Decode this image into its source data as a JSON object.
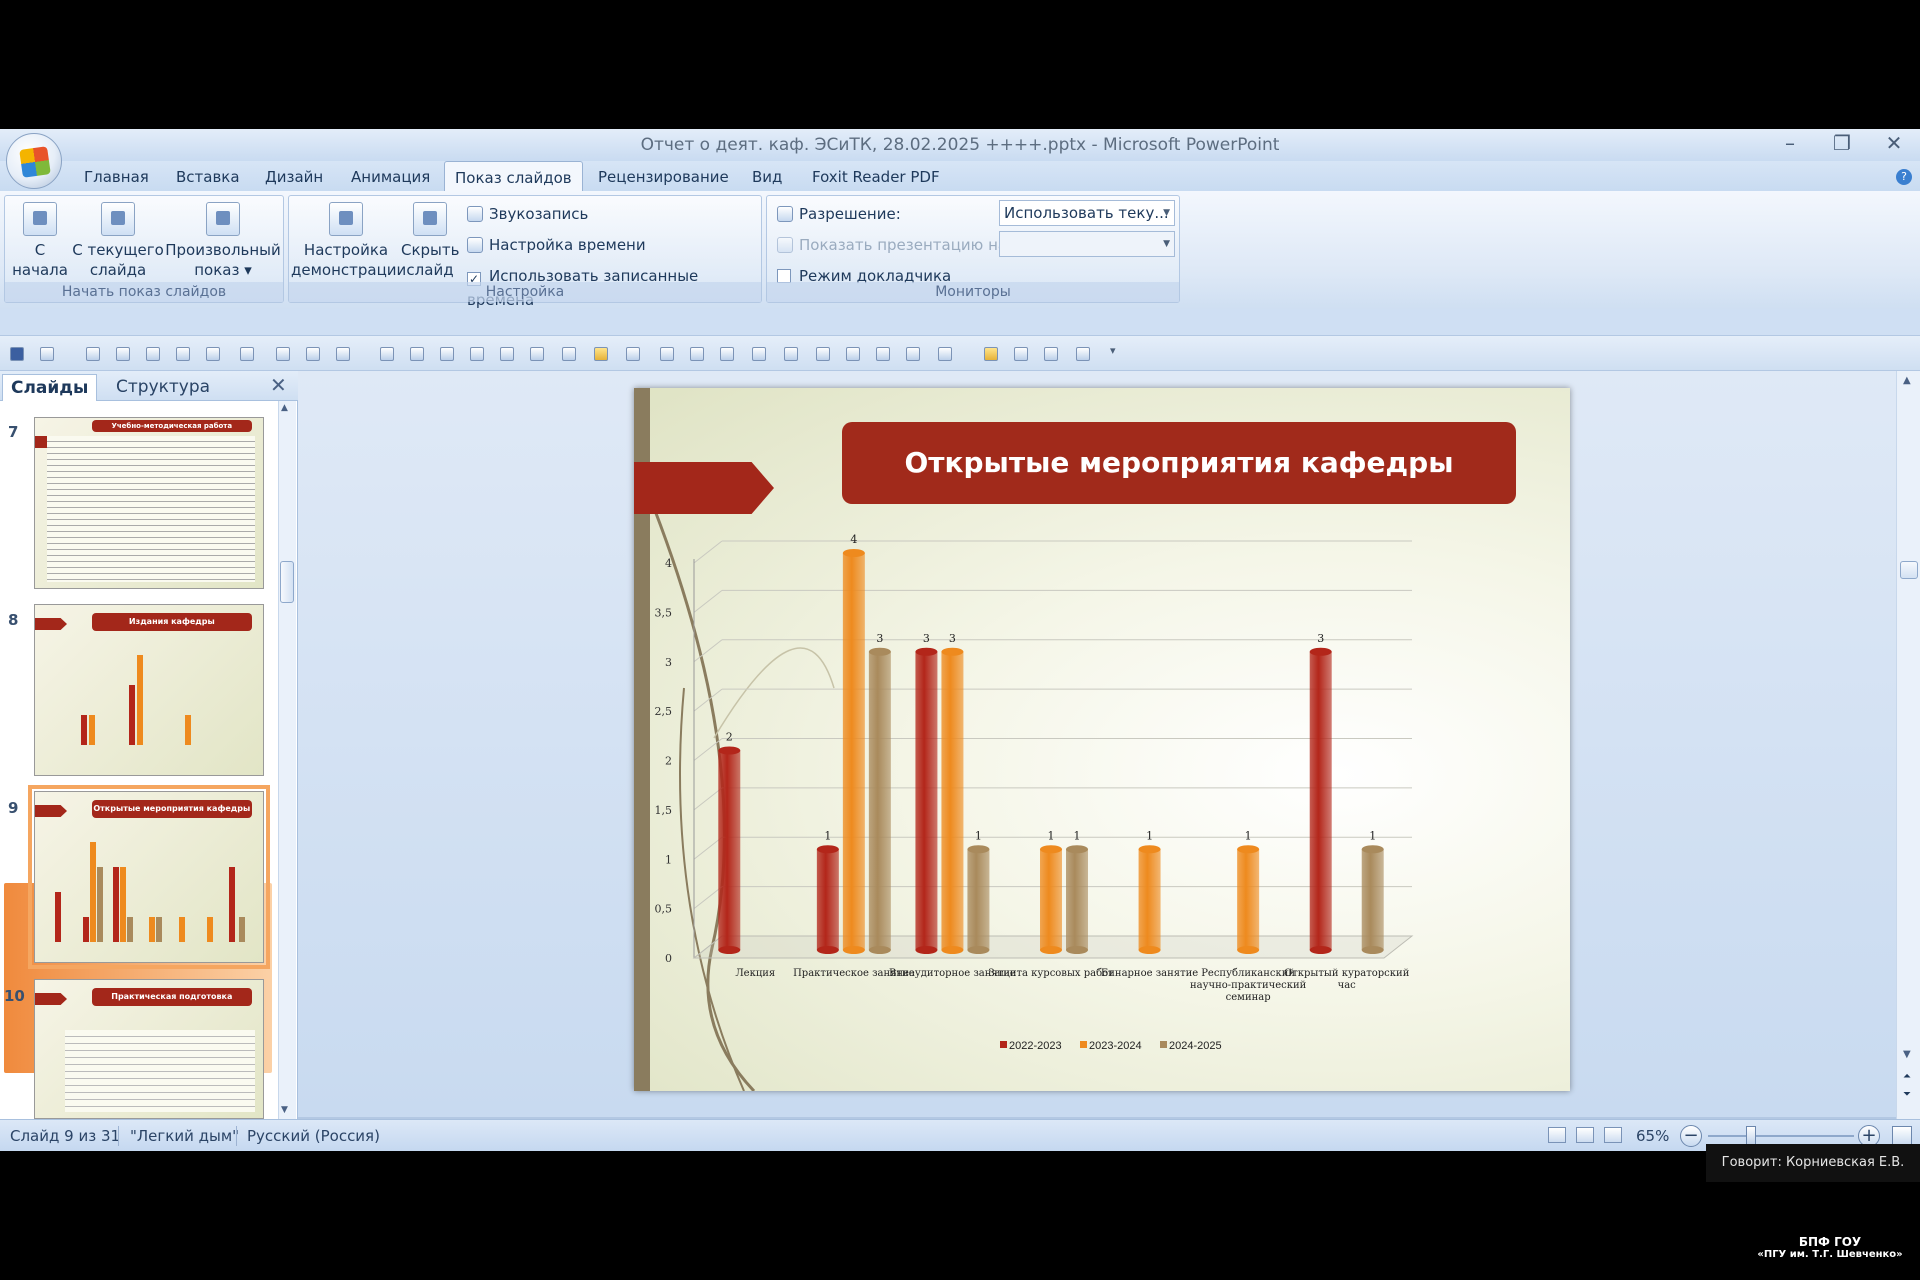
{
  "window": {
    "title": "Отчет о деят. каф. ЭСиТК, 28.02.2025 ++++.pptx - Microsoft PowerPoint"
  },
  "ribbon_tabs": [
    "Главная",
    "Вставка",
    "Дизайн",
    "Анимация",
    "Показ слайдов",
    "Рецензирование",
    "Вид",
    "Foxit Reader PDF"
  ],
  "active_tab": "Показ слайдов",
  "ribbon": {
    "start": {
      "label": "Начать показ слайдов",
      "from_start": "С\nначала",
      "from_current": "С текущего\nслайда",
      "custom": "Произвольный\nпоказ ▾"
    },
    "setup": {
      "label": "Настройка",
      "setup_show": "Настройка\nдемонстрации",
      "hide_slide": "Скрыть\nслайд",
      "record_narration": "Звукозапись",
      "rehearse_timings": "Настройка времени",
      "use_timings": "Использовать записанные времена",
      "use_timings_checked": true
    },
    "monitors": {
      "label": "Мониторы",
      "resolution_label": "Разрешение:",
      "resolution_value": "Использовать теку...",
      "show_on_label": "Показать презентацию на:",
      "presenter_view": "Режим докладчика"
    }
  },
  "slides_panel": {
    "tab_slides": "Слайды",
    "tab_outline": "Структура",
    "close_icon": "✕",
    "slides": [
      {
        "number": "7",
        "title": "Учебно-методическая работа"
      },
      {
        "number": "8",
        "title": "Издания кафедры"
      },
      {
        "number": "9",
        "title": "Открытые мероприятия кафедры",
        "selected": true
      },
      {
        "number": "10",
        "title": "Практическая подготовка"
      }
    ]
  },
  "slide": {
    "title": "Открытые мероприятия кафедры"
  },
  "chart_data": {
    "type": "bar",
    "title": "",
    "categories": [
      "Лекция",
      "Практическое занятие",
      "Внеаудиторное занятие",
      "Защита курсовых работ",
      "Бинарное занятие",
      "Республиканский научно-практический семинар",
      "Открытый кураторский час"
    ],
    "series": [
      {
        "name": "2022-2023",
        "color": "#b3261a",
        "values": [
          2,
          1,
          3,
          0,
          0,
          0,
          3
        ]
      },
      {
        "name": "2023-2024",
        "color": "#ee8a1e",
        "values": [
          0,
          4,
          3,
          1,
          1,
          1,
          0
        ]
      },
      {
        "name": "2024-2025",
        "color": "#a98a5c",
        "values": [
          0,
          3,
          1,
          1,
          0,
          0,
          1
        ]
      }
    ],
    "ylim": [
      0,
      4
    ],
    "yticks": [
      "0",
      "0,5",
      "1",
      "1,5",
      "2",
      "2,5",
      "3",
      "3,5",
      "4"
    ],
    "legend_position": "bottom",
    "grid": true
  },
  "status": {
    "slide_info": "Слайд 9 из 31",
    "theme": "\"Легкий дым\"",
    "language": "Русский (Россия)",
    "zoom": "65%"
  },
  "overlay": {
    "speaker": "Говорит: Корниевская Е.В.",
    "brand_line1": "БПФ ГОУ",
    "brand_line2": "«ПГУ им. Т.Г. Шевченко»"
  }
}
